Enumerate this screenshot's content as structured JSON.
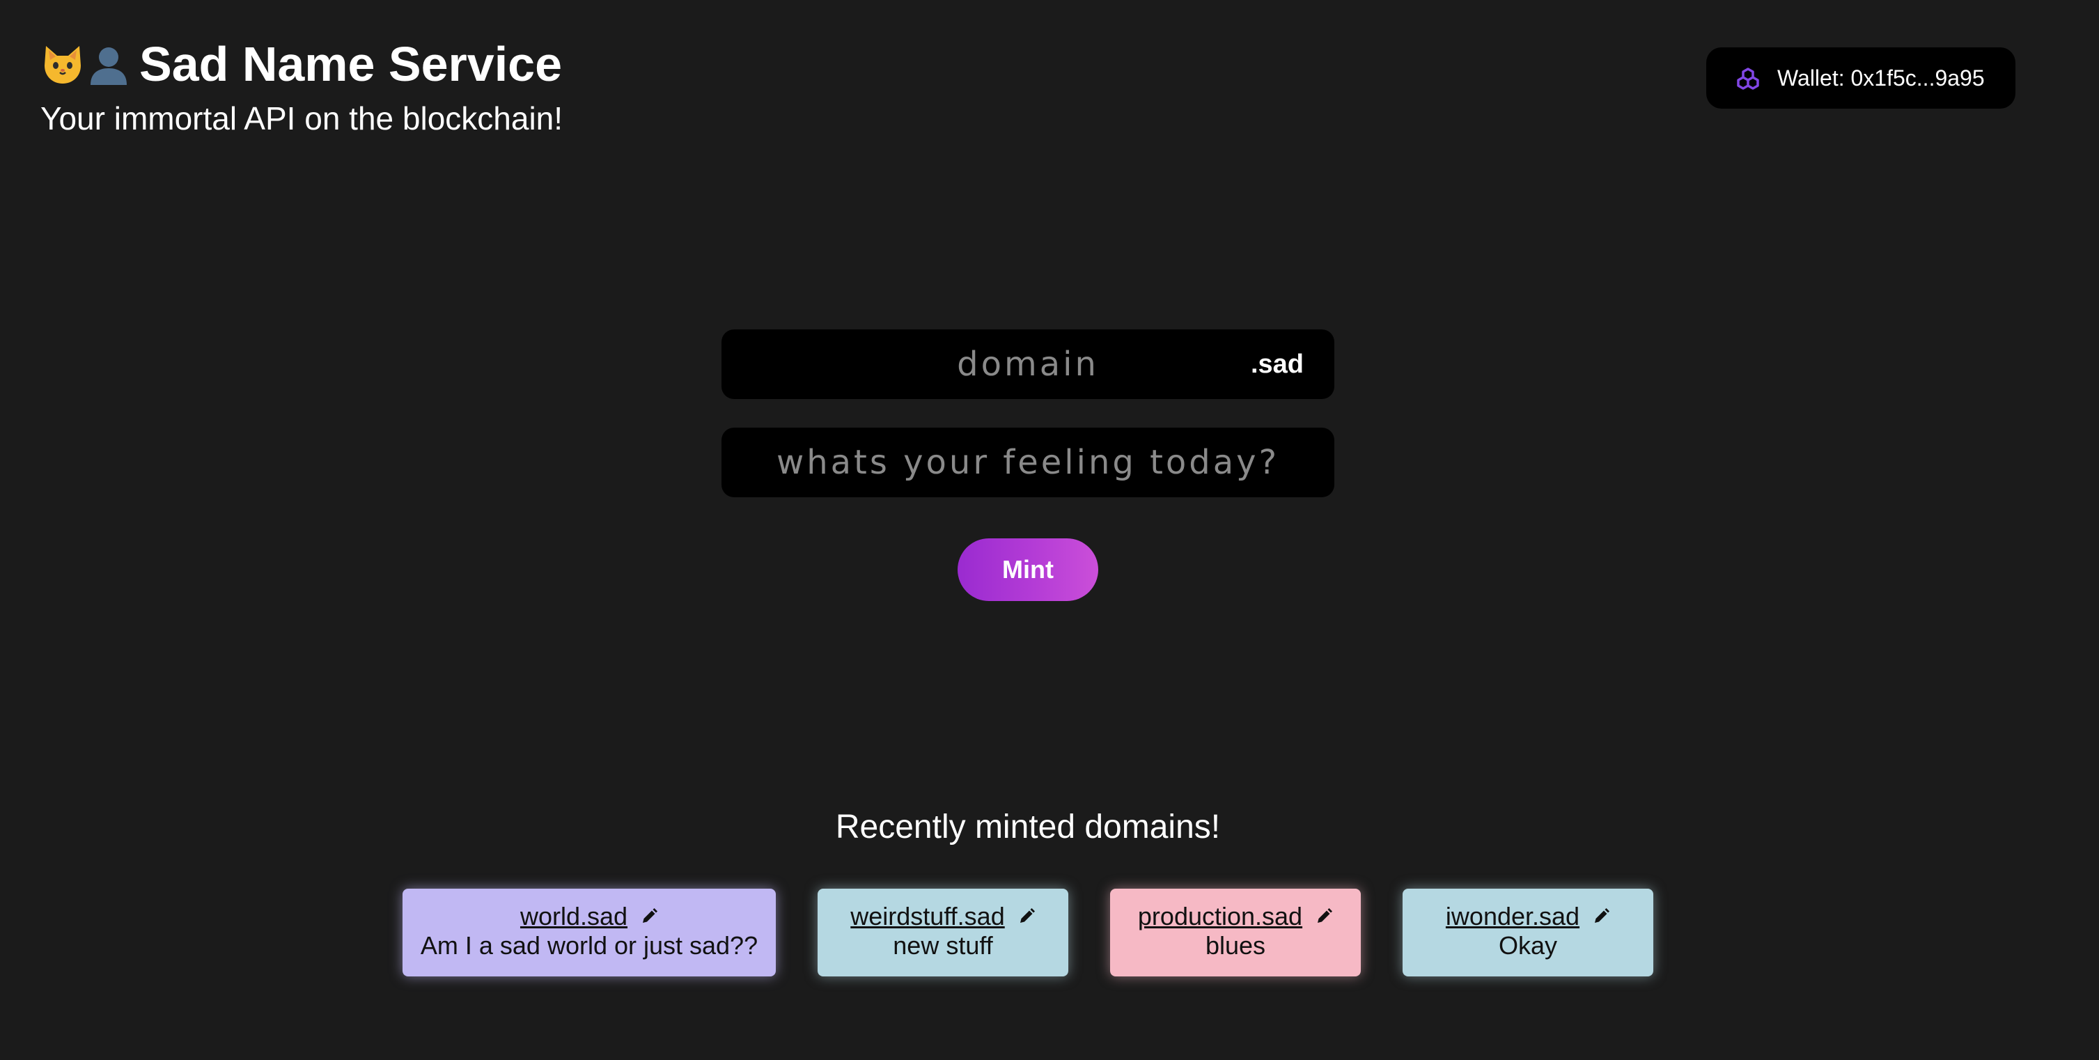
{
  "header": {
    "emoji_1": "cat-face",
    "emoji_2": "bust-in-silhouette",
    "title": "Sad Name Service",
    "subtitle": "Your immortal API on the blockchain!"
  },
  "wallet": {
    "icon": "polygon-icon",
    "label": "Wallet: 0x1f5c...9a95",
    "icon_color": "#8247e5"
  },
  "form": {
    "domain_placeholder": "domain",
    "domain_value": "",
    "tld": ".sad",
    "record_placeholder": "whats your feeling today?",
    "record_value": "",
    "mint_label": "Mint"
  },
  "recent": {
    "heading": "Recently minted domains!",
    "items": [
      {
        "name": "world.sad",
        "record": "Am I a sad world or just sad??",
        "color": "#c1b8f3"
      },
      {
        "name": "weirdstuff.sad",
        "record": "new stuff",
        "color": "#b5d8e2"
      },
      {
        "name": "production.sad",
        "record": "blues",
        "color": "#f6b9c5"
      },
      {
        "name": "iwonder.sad",
        "record": "Okay",
        "color": "#b5d8e2"
      }
    ]
  },
  "colors": {
    "background": "#1b1b1b",
    "field": "#000000",
    "mint_gradient_start": "#9a2bd0",
    "mint_gradient_end": "#cb4fd9"
  }
}
